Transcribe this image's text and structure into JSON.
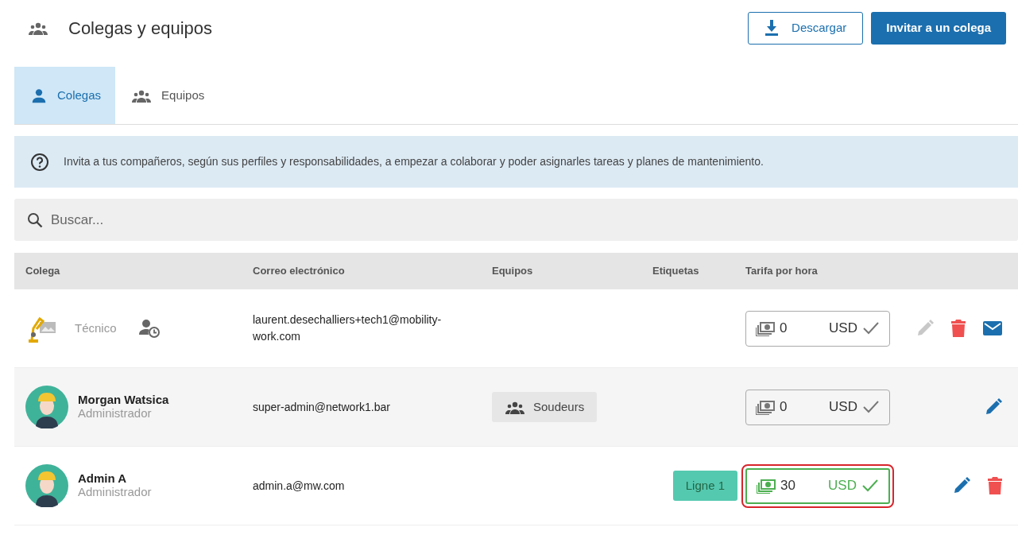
{
  "header": {
    "title": "Colegas y equipos",
    "buttons": [
      {
        "label": "Descargar",
        "kind": "outline"
      },
      {
        "label": "Invitar a un colega",
        "kind": "primary"
      }
    ]
  },
  "tabs": [
    {
      "label": "Colegas",
      "selected": true,
      "kind": "person"
    },
    {
      "label": "Equipos",
      "selected": false,
      "kind": "group"
    }
  ],
  "info": "Invita a tus compañeros, según sus perfiles y responsabilidades, a empezar a colaborar y poder asignarles tareas y planes de mantenimiento.",
  "search": {
    "placeholder": "Buscar..."
  },
  "table": {
    "columns": [
      "Colega",
      "Correo electrónico",
      "Equipos",
      "Etiquetas",
      "Tarifa por hora"
    ],
    "rows": [
      {
        "kind": "machine",
        "role": "Técnico",
        "pending": true,
        "email": "laurent.desechalliers+tech1@mobility-work.com",
        "teams": [],
        "tags": [],
        "rate": {
          "amount": "0",
          "currency": "USD",
          "valid": false,
          "highlighted": false
        },
        "actions": [
          {
            "kind": "edit",
            "disabled": true
          },
          {
            "kind": "delete",
            "disabled": false
          },
          {
            "kind": "mail",
            "disabled": false
          }
        ]
      },
      {
        "kind": "worker",
        "name": "Morgan Watsica",
        "role": "Administrador",
        "pending": false,
        "email": "super-admin@network1.bar",
        "teams": [
          "Soudeurs"
        ],
        "tags": [],
        "rate": {
          "amount": "0",
          "currency": "USD",
          "valid": false,
          "highlighted": false
        },
        "actions": [
          {
            "kind": "edit",
            "disabled": false
          }
        ]
      },
      {
        "kind": "worker",
        "name": "Admin A",
        "role": "Administrador",
        "pending": false,
        "email": "admin.a@mw.com",
        "teams": [],
        "tags": [
          {
            "label": "Ligne 1",
            "color": "#55c9b0"
          }
        ],
        "rate": {
          "amount": "30",
          "currency": "USD",
          "valid": true,
          "highlighted": true
        },
        "actions": [
          {
            "kind": "edit",
            "disabled": false
          },
          {
            "kind": "delete",
            "disabled": false
          }
        ]
      }
    ]
  }
}
